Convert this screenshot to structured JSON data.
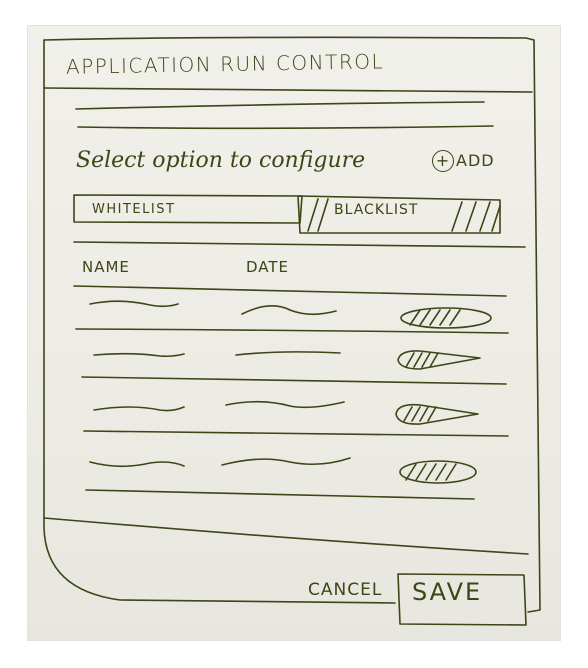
{
  "window": {
    "title": "APPLICATION RUN CONTROL"
  },
  "prompt": {
    "text": "Select option to configure"
  },
  "add": {
    "icon": "plus-circle-icon",
    "label": "ADD"
  },
  "tabs": [
    {
      "label": "WHITELIST",
      "selected": false
    },
    {
      "label": "BLACKLIST",
      "selected": true
    }
  ],
  "table": {
    "columns": [
      "NAME",
      "DATE"
    ],
    "row_count_visible": 4
  },
  "footer": {
    "cancel_label": "CANCEL",
    "save_label": "SAVE"
  },
  "colors": {
    "ink": "#3e4516",
    "paper": "#eeede6"
  }
}
